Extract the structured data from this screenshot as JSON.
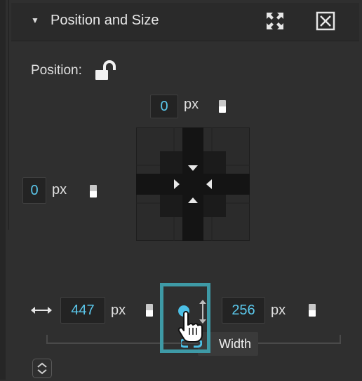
{
  "panel": {
    "title": "Position and Size",
    "expand_icon": "expand-icon",
    "close_icon": "close-box-icon"
  },
  "position": {
    "label": "Position:",
    "lock_icon": "unlocked-padlock-icon",
    "top": {
      "value": "0",
      "unit": "px"
    },
    "left": {
      "value": "0",
      "unit": "px"
    }
  },
  "size": {
    "width": {
      "value": "447",
      "unit": "px"
    },
    "height": {
      "value": "256",
      "unit": "px"
    },
    "tooltip": "Width"
  },
  "colors": {
    "accent_value": "#5bc8ec",
    "highlight_border": "#3e9aa6",
    "panel_bg": "#2f2f2f"
  }
}
